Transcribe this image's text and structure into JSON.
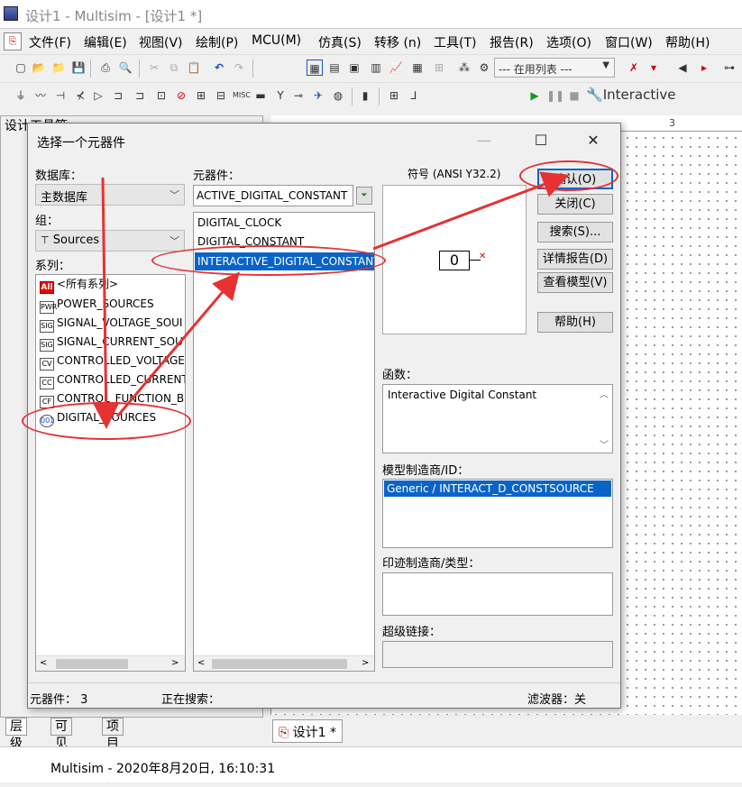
{
  "window": {
    "title": "设计1 - Multisim - [设计1 *]"
  },
  "menu": [
    "文件(F)",
    "编辑(E)",
    "视图(V)",
    "绘制(P)",
    "MCU(M)",
    "仿真(S)",
    "转移 (n)",
    "工具(T)",
    "报告(R)",
    "选项(O)",
    "窗口(W)",
    "帮助(H)"
  ],
  "toolbar": {
    "in_use_list": "--- 在用列表 ---",
    "interactive_label": "Interactive"
  },
  "left_panel": {
    "title": "设计工具箱",
    "tabs": [
      "层级",
      "可见度",
      "项目视图"
    ]
  },
  "document_tab": "设计1 *",
  "status_bar": "Multisim  -  2020年8月20日, 16:10:31",
  "ruler_mark": "3",
  "dialog": {
    "title": "选择一个元器件",
    "database_label": "数据库：",
    "database_value": "主数据库",
    "group_label": "组：",
    "group_value": "Sources",
    "family_label": "系列：",
    "families": [
      {
        "icon": "All",
        "label": "<所有系列>"
      },
      {
        "icon": "PWR",
        "label": "POWER_SOURCES"
      },
      {
        "icon": "SIG",
        "label": "SIGNAL_VOLTAGE_SOUI"
      },
      {
        "icon": "SIG",
        "label": "SIGNAL_CURRENT_SOU"
      },
      {
        "icon": "CV",
        "label": "CONTROLLED_VOLTAGE"
      },
      {
        "icon": "CC",
        "label": "CONTROLLED_CURRENT"
      },
      {
        "icon": "CF",
        "label": "CONTROL_FUNCTION_B"
      },
      {
        "icon": "001",
        "label": "DIGITAL_SOURCES"
      }
    ],
    "component_label": "元器件：",
    "component_value": "ACTIVE_DIGITAL_CONSTANT",
    "components": [
      "DIGITAL_CLOCK",
      "DIGITAL_CONSTANT",
      "INTERACTIVE_DIGITAL_CONSTANT"
    ],
    "symbol_label": "符号 (ANSI Y32.2)",
    "symbol_value": "0",
    "buttons": [
      "确认(O)",
      "关闭(C)",
      "搜索(S)...",
      "详情报告(D)",
      "查看模型(V)",
      "帮助(H)"
    ],
    "function_label": "函数：",
    "function_value": "Interactive Digital Constant",
    "model_label": "模型制造商/ID：",
    "model_value": "Generic / INTERACT_D_CONSTSOURCE",
    "footprint_label": "印迹制造商/类型：",
    "hyperlink_label": "超级链接：",
    "status": {
      "count": "元器件：  3",
      "searching": "正在搜索：",
      "filter": "滤波器：关"
    }
  },
  "annotation_color": "#e63232"
}
